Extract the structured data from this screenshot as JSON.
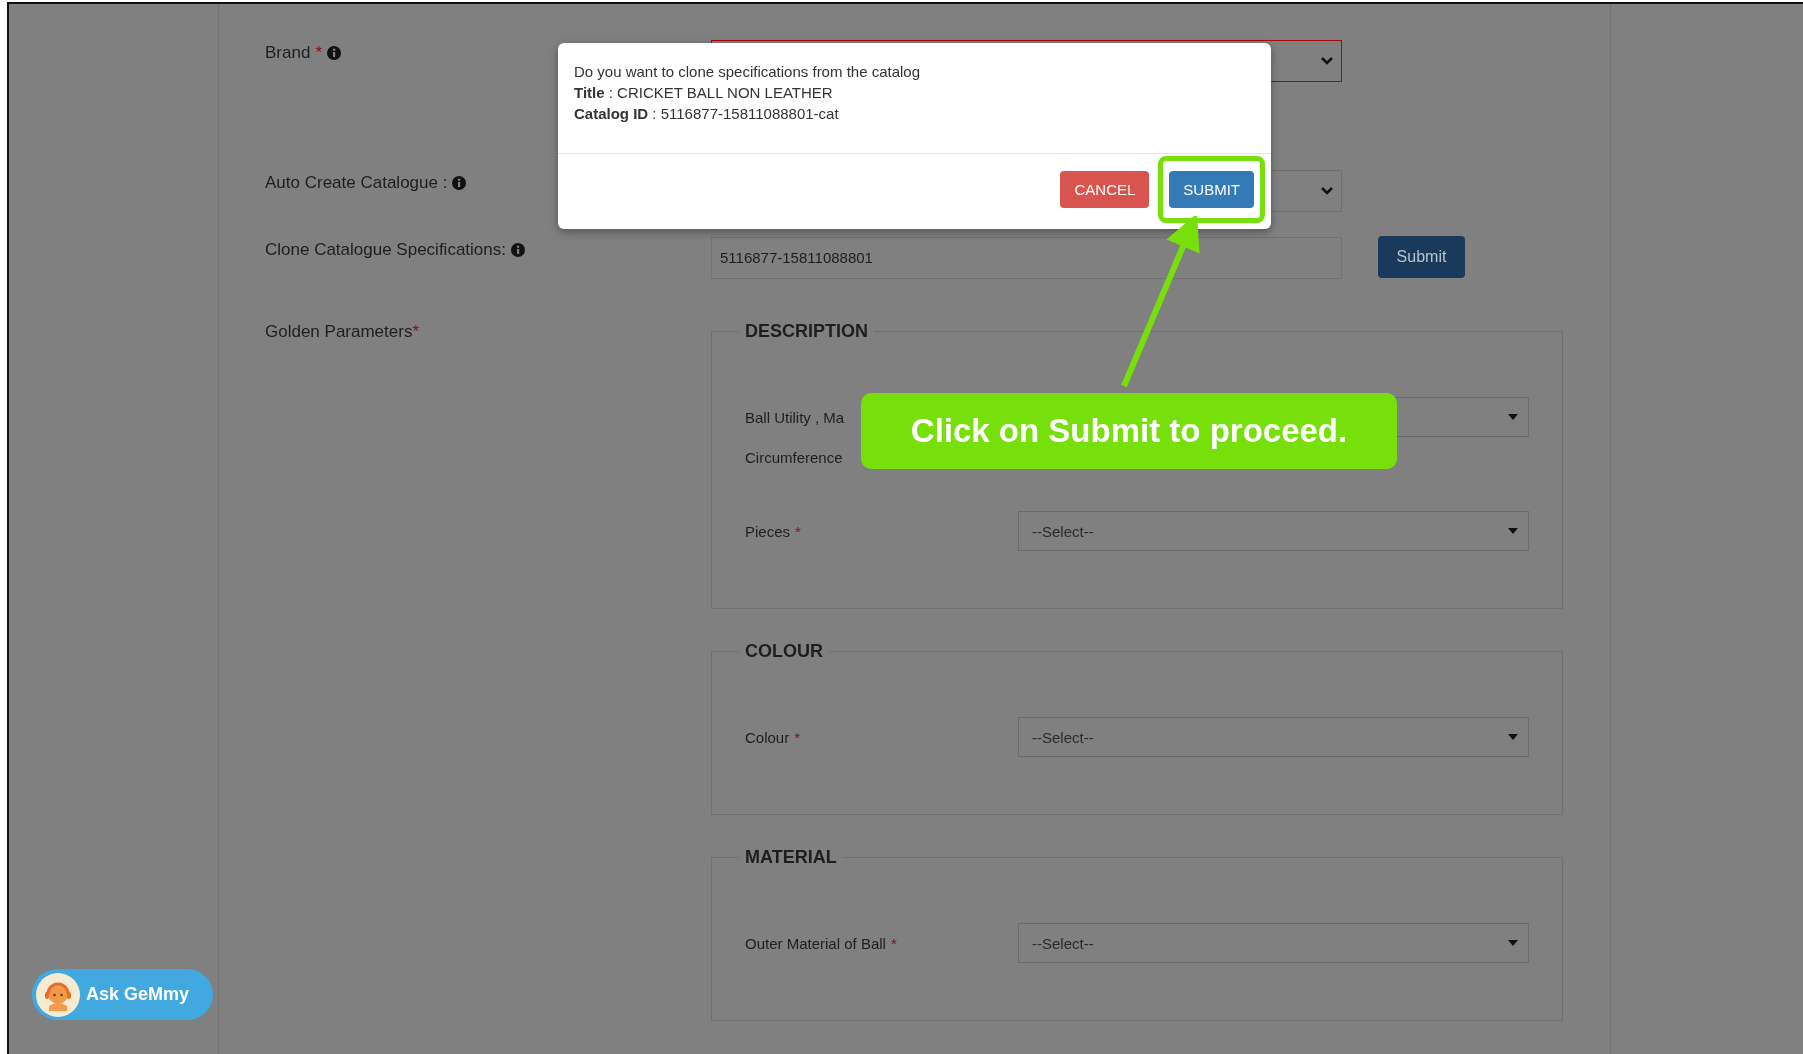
{
  "form": {
    "rows": [
      {
        "kind": "select",
        "label": "Brand",
        "mark": "*",
        "info": true,
        "invalid": true
      },
      {
        "kind": "select",
        "label": "Auto Create Catalogue :",
        "info": true,
        "invalid": false
      },
      {
        "kind": "input",
        "label": "Clone Catalogue Specifications:",
        "info": true,
        "value": "5116877-15811088801",
        "button": "Submit"
      }
    ]
  },
  "golden_parameters": {
    "label": "Golden Parameters",
    "mark": "*",
    "sections": [
      {
        "title": "DESCRIPTION",
        "fields": [
          {
            "kind": "select",
            "label": "Ball Utility , Ma"
          },
          {
            "kind": "text",
            "label": "Circumference"
          },
          {
            "kind": "select",
            "label": "Pieces",
            "mark": "*",
            "value": "--Select--"
          }
        ]
      },
      {
        "title": "COLOUR",
        "fields": [
          {
            "kind": "select",
            "label": "Colour",
            "mark": "*",
            "value": "--Select--"
          }
        ]
      },
      {
        "title": "MATERIAL",
        "fields": [
          {
            "kind": "select",
            "label": "Outer Material of Ball",
            "mark": "*",
            "value": "--Select--"
          }
        ]
      }
    ]
  },
  "dialog": {
    "message": "Do you want to clone specifications from the catalog",
    "lines": [
      "**Title** : CRICKET BALL NON LEATHER",
      "**Catalog ID** : 5116877-15811088801-cat"
    ],
    "buttons": [
      {
        "label": "CANCEL",
        "kind": "danger",
        "highlighted": false
      },
      {
        "label": "SUBMIT",
        "kind": "primary",
        "highlighted": true
      }
    ]
  },
  "callout": {
    "text": "Click on Submit to proceed."
  },
  "chat_button": {
    "label": "Ask GeMmy"
  }
}
